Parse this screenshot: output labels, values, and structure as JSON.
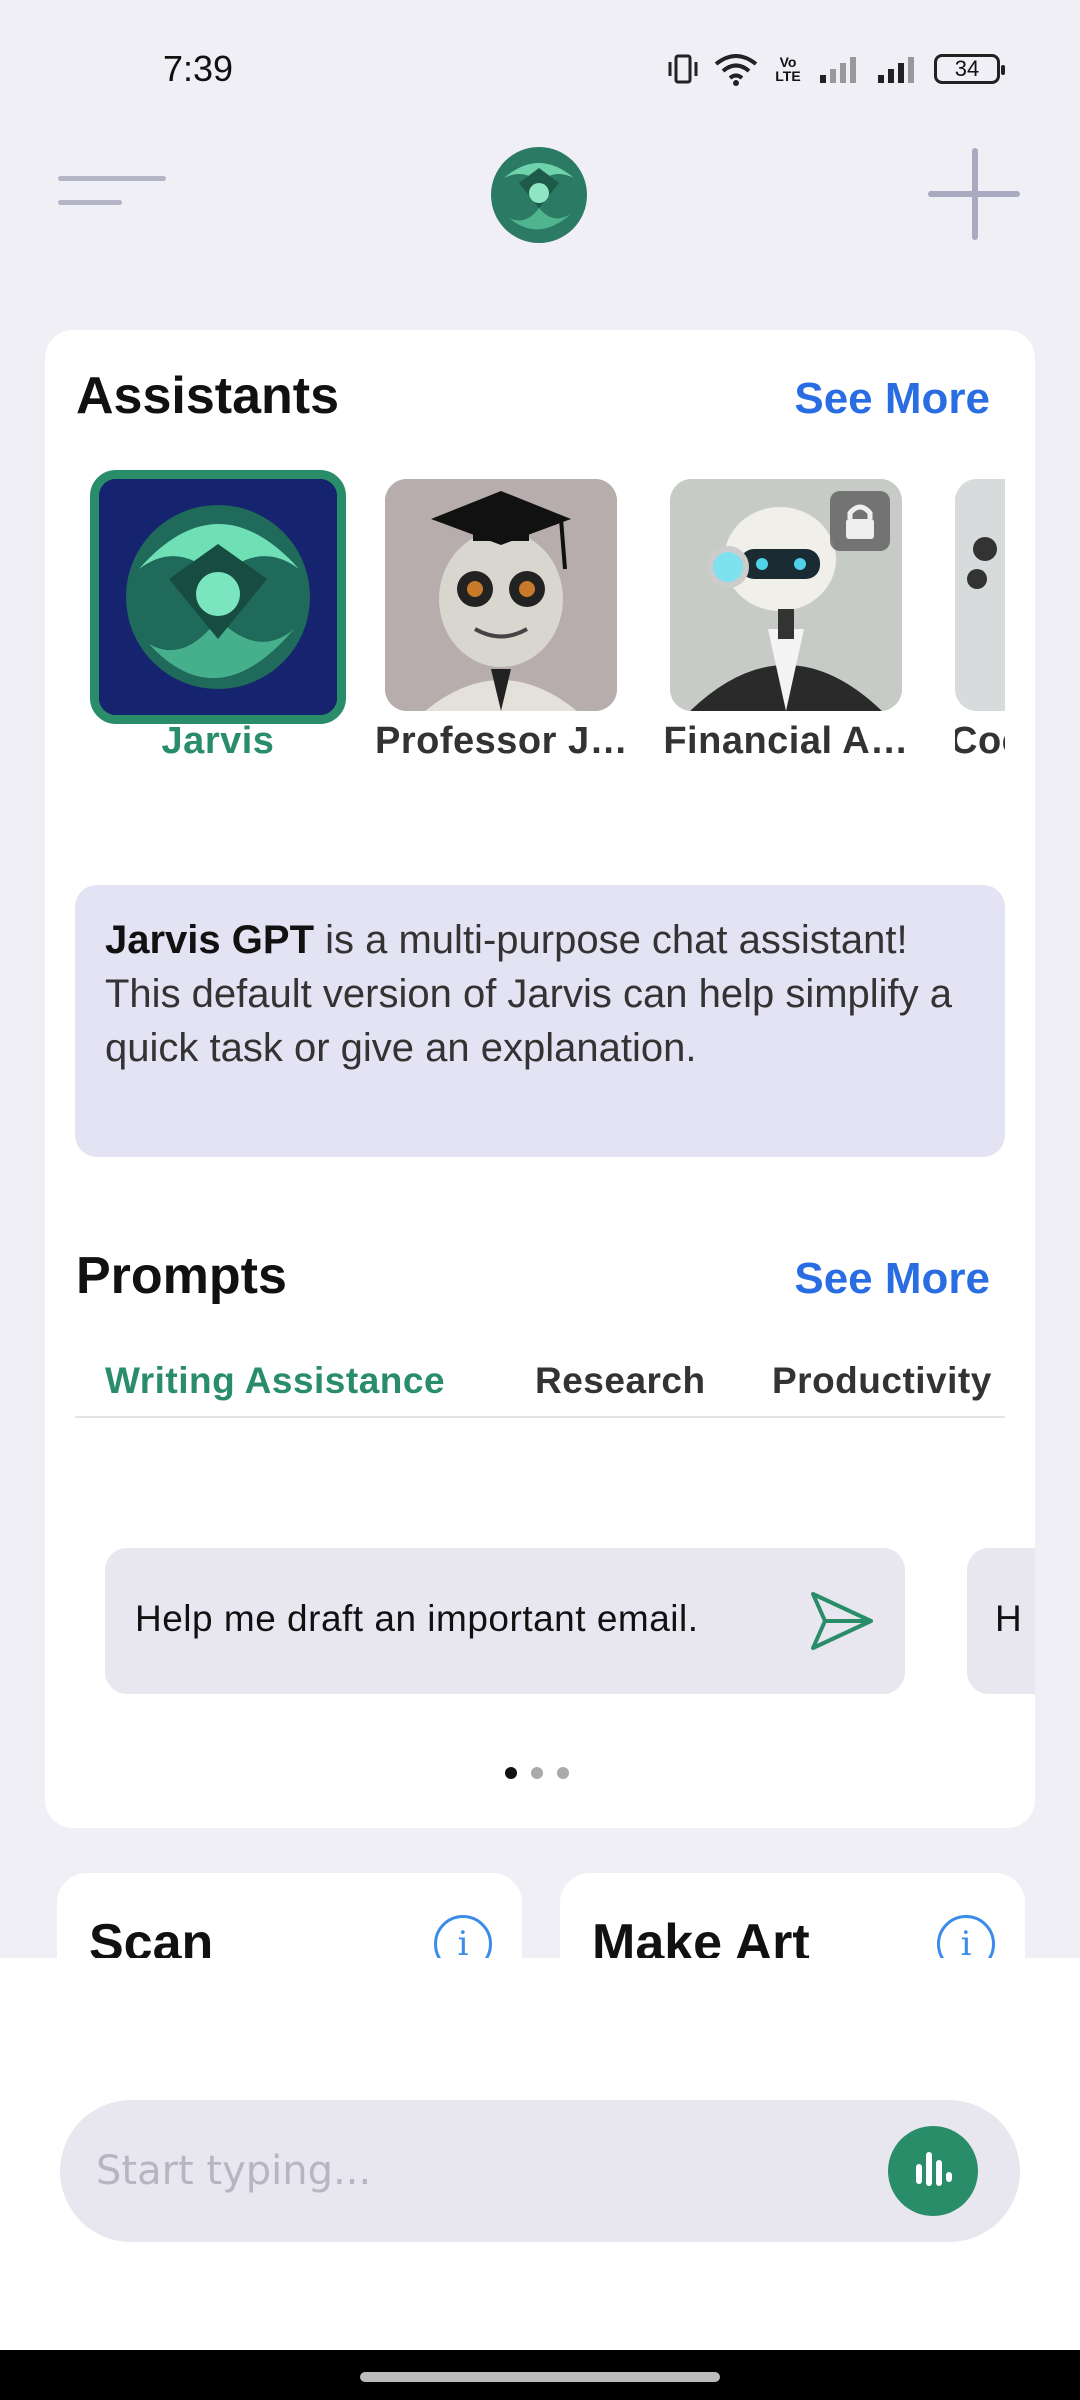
{
  "status_bar": {
    "time": "7:39",
    "battery": "34",
    "volte_label": "Vo LTE"
  },
  "header": {
    "menu_icon": "hamburger-icon",
    "logo": "jarvis-logo",
    "add_icon": "plus-icon"
  },
  "assistants": {
    "title": "Assistants",
    "see_more": "See More",
    "items": [
      {
        "name": "Jarvis",
        "selected": true
      },
      {
        "name": "Professor J…",
        "selected": false
      },
      {
        "name": "Financial A…",
        "selected": false,
        "locked": true
      },
      {
        "name": "Coc",
        "selected": false
      }
    ],
    "description_bold": "Jarvis GPT",
    "description_rest": " is a multi-purpose chat assistant! This default version of Jarvis can help simplify a quick task or give an explanation."
  },
  "prompts": {
    "title": "Prompts",
    "see_more": "See More",
    "tabs": [
      {
        "label": "Writing Assistance",
        "active": true
      },
      {
        "label": "Research",
        "active": false
      },
      {
        "label": "Productivity",
        "active": false
      }
    ],
    "cards": [
      {
        "text": "Help me draft an important email."
      },
      {
        "text": "H"
      }
    ],
    "page_count": 3,
    "current_page": 1
  },
  "features": [
    {
      "title": "Scan"
    },
    {
      "title": "Make Art"
    }
  ],
  "composer": {
    "placeholder": "Start typing..."
  },
  "colors": {
    "accent_green": "#2a8d69",
    "link_blue": "#2a6de3",
    "background": "#f0eff6",
    "description_bg": "#e4e3f3"
  }
}
